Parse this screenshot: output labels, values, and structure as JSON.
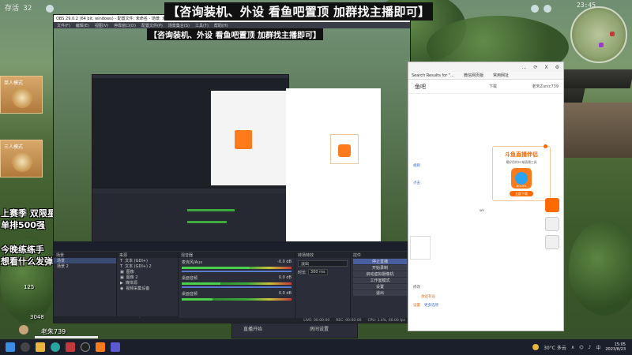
{
  "game": {
    "timer": "存活 32",
    "clock": "23:45"
  },
  "banner": "【咨询装机、外设 看鱼吧置顶 加群找主播即可】",
  "preview_banner": "【咨询装机、外设 看鱼吧置顶 加群找主播即可】",
  "left_overlay": {
    "tiles": [
      {
        "label": "单人模式"
      },
      {
        "label": "三人模式"
      }
    ],
    "season_line1": "上赛季 双限星",
    "season_line2": "单排500强",
    "practice_line1": "今晚练练手",
    "practice_line2": "想看什么发弹幕",
    "chat_user": "老朱739",
    "chat_level": "125",
    "chat_count": "3048"
  },
  "obs": {
    "title": "OBS 29.0.2 (64 bit, windows) - 配置文件: 未命名 - 场景: 未命名",
    "menu": [
      "文件(F)",
      "编辑(E)",
      "视图(V)",
      "停靠窗口(D)",
      "配置文件(P)",
      "场景集合(S)",
      "工具(T)",
      "帮助(H)"
    ],
    "win_controls": [
      "—",
      "☐",
      "✕"
    ],
    "docks": {
      "scenes_title": "场景",
      "scenes": [
        "场景",
        "场景 2"
      ],
      "sources_title": "来源",
      "sources": [
        "文本 (GDI+)",
        "文本 (GDI+) 2",
        "图像",
        "图像 2",
        "媒体源",
        "视频采集设备"
      ],
      "mixer_title": "混音器",
      "mixer": [
        {
          "name": "麦克风/Aux",
          "db": "-0.0 dB",
          "level": 0.62
        },
        {
          "name": "桌面音频",
          "db": "0.0 dB",
          "level": 0.35
        },
        {
          "name": "桌面音频",
          "db": "0.0 dB",
          "level": 0.28
        }
      ],
      "transition_title": "转场特效",
      "transition_type": "淡出",
      "duration_label": "时长",
      "duration_value": "300 ms",
      "controls_title": "控件",
      "controls": [
        "停止直播",
        "开始录制",
        "启动虚拟摄像机",
        "工作室模式",
        "设置",
        "退出"
      ]
    },
    "status": {
      "live": "LIVE: 00:00:00",
      "rec": "REC: 00:00:00",
      "cpu": "CPU: 1.4%, 60.00 fps"
    }
  },
  "browser": {
    "top_items": [
      "…",
      "⟳",
      "X",
      "⚙"
    ],
    "bookmarks": [
      "Search Results for \"...",
      "微信网页版",
      "常用网址"
    ],
    "site_title": "鱼吧",
    "download": "下载",
    "user": "老朱Zunic739",
    "links": [
      "规则",
      "点击",
      "ws"
    ],
    "bottom_text": [
      "修改",
      "会议有设",
      "设置",
      "更多选项"
    ],
    "promo": {
      "title": "斗鱼直播伴侣",
      "subtitle": "最好用的PC端直播工具",
      "logo_text": "DOUYU",
      "button": "立即下载"
    }
  },
  "game_panel": {
    "item1": "直播开始",
    "item2": "房间设置"
  },
  "taskbar": {
    "weather": "30°C 多云",
    "lang": "中",
    "time": "15:05",
    "date": "2023/8/23"
  }
}
